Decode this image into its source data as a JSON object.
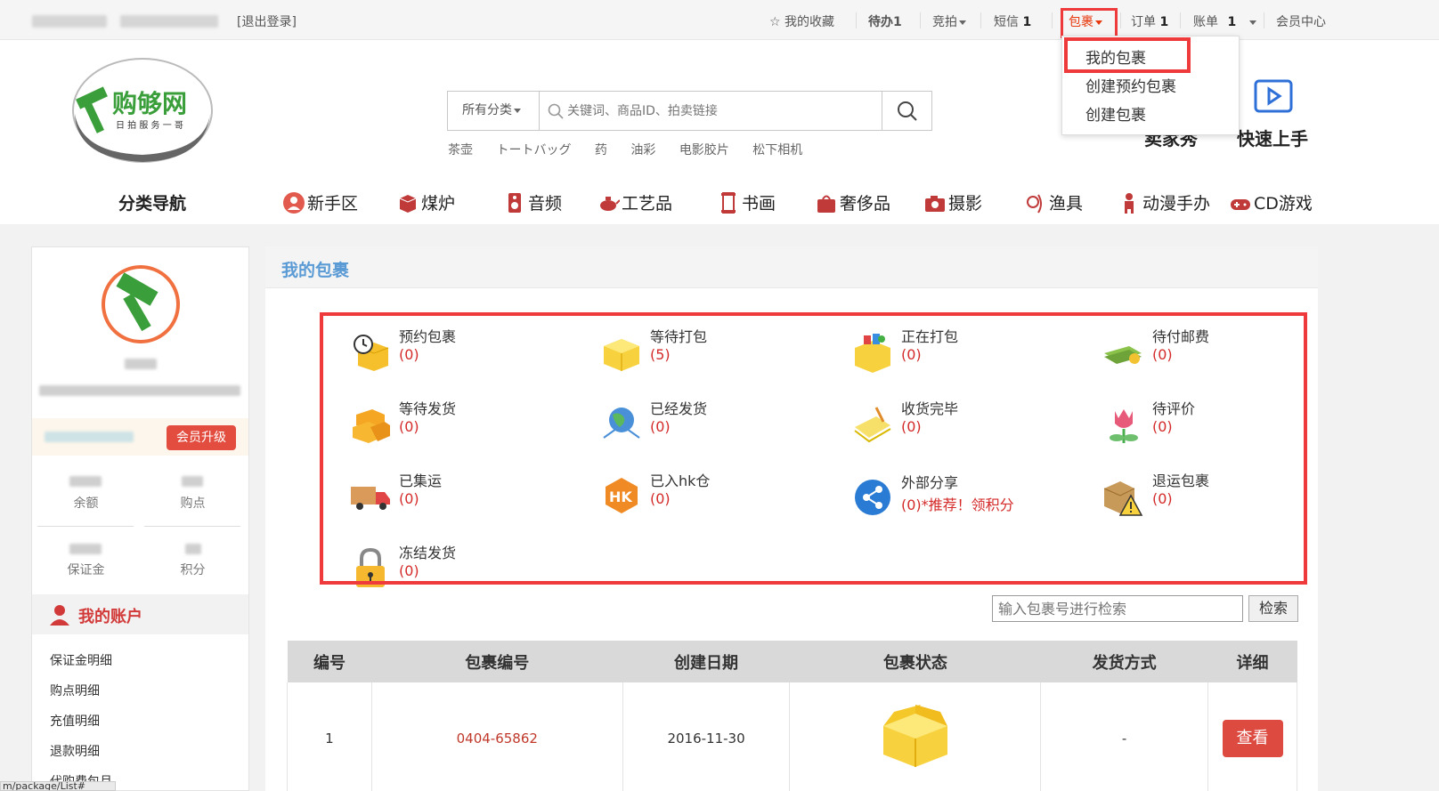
{
  "topbar": {
    "logout": "[退出登录]",
    "favorites": "我的收藏",
    "todo": "待办",
    "todo_count": "1",
    "auction": "竞拍",
    "sms": "短信",
    "sms_count": "1",
    "parcel": "包裹",
    "order": "订单",
    "order_count": "1",
    "bill": "账单",
    "bill_count": "1",
    "member_center": "会员中心"
  },
  "dropdown": {
    "items": [
      "我的包裹",
      "创建预约包裹",
      "创建包裹"
    ]
  },
  "logo": {
    "name": "购够网",
    "slogan": "日 拍 服 务 一 哥"
  },
  "search": {
    "category": "所有分类",
    "placeholder": "关键词、商品ID、拍卖链接",
    "hotwords": [
      "茶壶",
      "トートバッグ",
      "药",
      "油彩",
      "电影胶片",
      "松下相机"
    ]
  },
  "quick": {
    "left": "卖家秀",
    "right": "快速上手"
  },
  "nav": {
    "title": "分类导航",
    "items": [
      "新手区",
      "煤炉",
      "音频",
      "工艺品",
      "书画",
      "奢侈品",
      "摄影",
      "渔具",
      "动漫手办",
      "CD游戏"
    ]
  },
  "sidebar": {
    "vip_button": "会员升级",
    "stats": [
      "余额",
      "购点",
      "保证金",
      "积分"
    ],
    "account_title": "我的账户",
    "menu": [
      "保证金明细",
      "购点明细",
      "充值明细",
      "退款明细",
      "代购费包月"
    ]
  },
  "main": {
    "title": "我的包裹",
    "grid": [
      {
        "label": "预约包裹",
        "count": "(0)"
      },
      {
        "label": "等待打包",
        "count": "(5)"
      },
      {
        "label": "正在打包",
        "count": "(0)"
      },
      {
        "label": "待付邮费",
        "count": "(0)"
      },
      {
        "label": "等待发货",
        "count": "(0)"
      },
      {
        "label": "已经发货",
        "count": "(0)"
      },
      {
        "label": "收货完毕",
        "count": "(0)"
      },
      {
        "label": "待评价",
        "count": "(0)"
      },
      {
        "label": "已集运",
        "count": "(0)"
      },
      {
        "label": "已入hk仓",
        "count": "(0)"
      },
      {
        "label": "外部分享",
        "count": "(0)*推荐！领积分"
      },
      {
        "label": "退运包裹",
        "count": "(0)"
      },
      {
        "label": "冻结发货",
        "count": "(0)"
      }
    ],
    "search_placeholder": "输入包裹号进行检索",
    "search_button": "检索",
    "table": {
      "headers": [
        "编号",
        "包裹编号",
        "创建日期",
        "包裹状态",
        "发货方式",
        "详细"
      ],
      "rows": [
        {
          "no": "1",
          "parcel_no": "0404-65862",
          "date": "2016-11-30",
          "ship": "-",
          "detail": "查看"
        }
      ]
    }
  },
  "status_url": "m/package/List#",
  "colors": {
    "accent_red": "#e24d3f",
    "highlight": "#ee3a3a",
    "title_blue": "#5b9bd5"
  }
}
